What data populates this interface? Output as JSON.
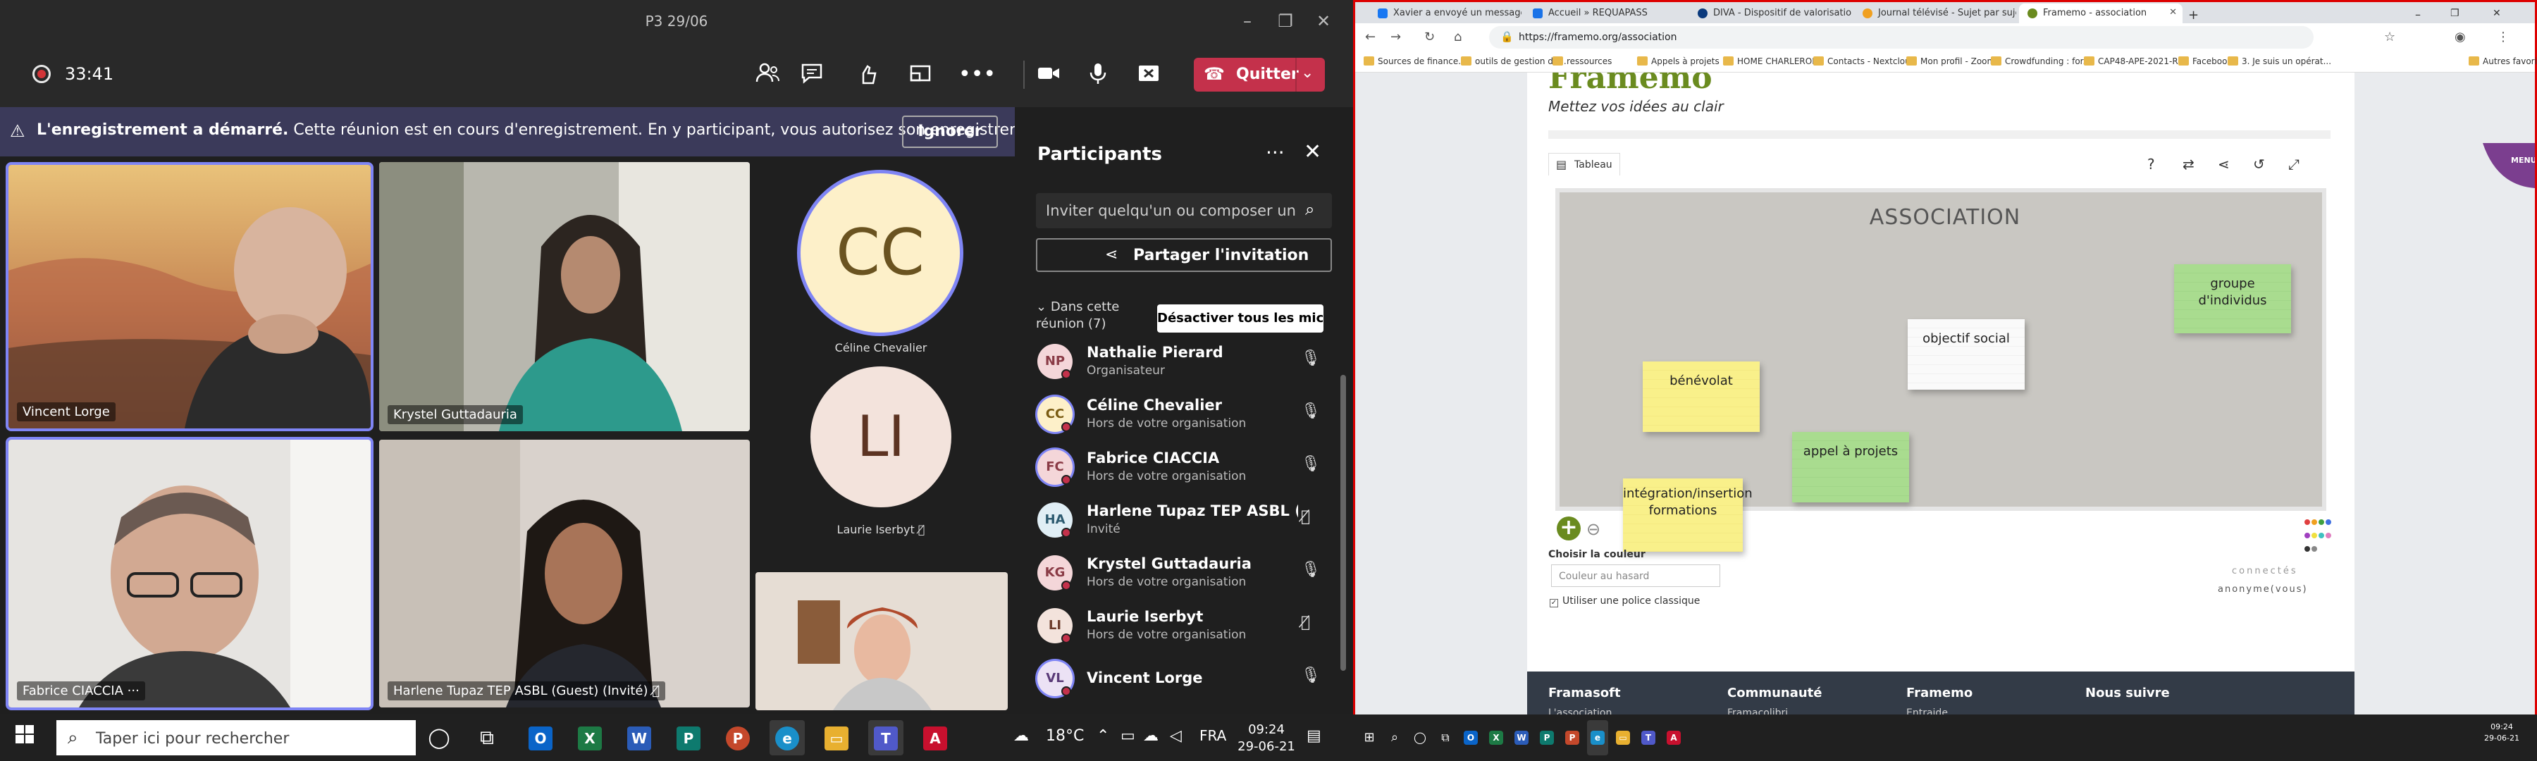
{
  "teams": {
    "window_title": "P3 29/06",
    "timer": "33:41",
    "leave_label": "Quitter",
    "banner": {
      "bold": "L'enregistrement a démarré.",
      "text": " Cette réunion est en cours d'enregistrement. En y participant, vous autorisez son enregistrement...",
      "ignore_label": "Ignorer"
    },
    "tiles": [
      {
        "name": "Vincent Lorge",
        "bg": "#8a6d4f"
      },
      {
        "name": "Krystel Guttadauria",
        "bg": "#c4c1b8"
      },
      {
        "name": "Fabrice CIACCIA",
        "bg": "#e4e2df"
      },
      {
        "name": "Harlene Tupaz TEP ASBL (Guest) (Invité)",
        "bg": "#d6cfc8"
      }
    ],
    "avatars": [
      {
        "initials": "CC",
        "name": "Céline Chevalier"
      },
      {
        "initials": "LI",
        "name": "Laurie Iserbyt"
      }
    ],
    "panel": {
      "title": "Participants",
      "search_placeholder": "Inviter quelqu'un ou composer un numéro",
      "share_label": "Partager l'invitation",
      "in_meeting": "Dans cette réunion (7)",
      "mute_all": "Désactiver tous les micros",
      "people": [
        {
          "initials": "NP",
          "name": "Nathalie Pierard",
          "role": "Organisateur",
          "avbg": "#f4d6d9",
          "avfg": "#8a3b46"
        },
        {
          "initials": "CC",
          "name": "Céline Chevalier",
          "role": "Hors de votre organisation",
          "avbg": "#fdf0c9",
          "avfg": "#7a5b12"
        },
        {
          "initials": "FC",
          "name": "Fabrice CIACCIA",
          "role": "Hors de votre organisation",
          "avbg": "#f4d6d9",
          "avfg": "#8a3b46"
        },
        {
          "initials": "HA",
          "name": "Harlene Tupaz TEP ASBL (Guest)",
          "role": "Invité",
          "avbg": "#e0eef5",
          "avfg": "#2c5a70"
        },
        {
          "initials": "KG",
          "name": "Krystel Guttadauria",
          "role": "Hors de votre organisation",
          "avbg": "#f4d6d9",
          "avfg": "#8a3b46"
        },
        {
          "initials": "LI",
          "name": "Laurie Iserbyt",
          "role": "Hors de votre organisation",
          "avbg": "#f3e3dc",
          "avfg": "#6b3b2a"
        },
        {
          "initials": "VL",
          "name": "Vincent Lorge",
          "role": "",
          "avbg": "#ece2f5",
          "avfg": "#5a3a78"
        }
      ]
    }
  },
  "chrome": {
    "tabs": [
      "Xavier a envoyé un message à vous",
      "Accueil » REQUAPASS",
      "DIVA - Dispositif de valorisation",
      "Journal télévisé - Sujet par sujet",
      "Framemo - association"
    ],
    "url": "https://framemo.org/association",
    "bookmarks": [
      "Sources de finance...",
      "outils de gestion de...",
      "ressources",
      "Appels à projets",
      "HOME CHARLEROI...",
      "Contacts - Nextcloud",
      "Mon profil - Zoom",
      "Crowdfunding : for...",
      "CAP48-APE-2021-R...",
      "Facebook",
      "3. Je suis un opérat...",
      "Autres favoris"
    ],
    "page": {
      "logo": "Framemo",
      "tagline": "Mettez vos idées au clair",
      "board_tab": "Tableau",
      "board_title": "ASSOCIATION",
      "notes": [
        {
          "text": "groupe d'individus",
          "color": "green"
        },
        {
          "text": "objectif social",
          "color": "white"
        },
        {
          "text": "bénévolat",
          "color": "yellow"
        },
        {
          "text": "appel à projets",
          "color": "green"
        },
        {
          "text": "intégration/insertion formations",
          "color": "yellow"
        }
      ],
      "color_label": "Choisir la couleur",
      "color_placeholder": "Couleur au hasard",
      "classic_font": "Utiliser une police classique",
      "connectes": "connectés",
      "anonyme": "anonyme(vous)",
      "footer": [
        {
          "h": "Framasoft",
          "s": "L'association"
        },
        {
          "h": "Communauté",
          "s": "Framacolibri"
        },
        {
          "h": "Framemo",
          "s": "Entraide"
        },
        {
          "h": "Nous suivre",
          "s": ""
        }
      ],
      "menu": "MENU"
    }
  },
  "taskbar": {
    "search_placeholder": "Taper ici pour rechercher",
    "weather": "18°C",
    "lang": "FRA",
    "time": "09:24",
    "date": "29-06-21",
    "right_time": "09:24",
    "right_date": "29-06-21"
  },
  "colors": {
    "teams_bg": "#1f1f1f",
    "teams_accent": "#7f85f5",
    "leave": "#c4314b",
    "framemo_green": "#6a8b1f"
  }
}
